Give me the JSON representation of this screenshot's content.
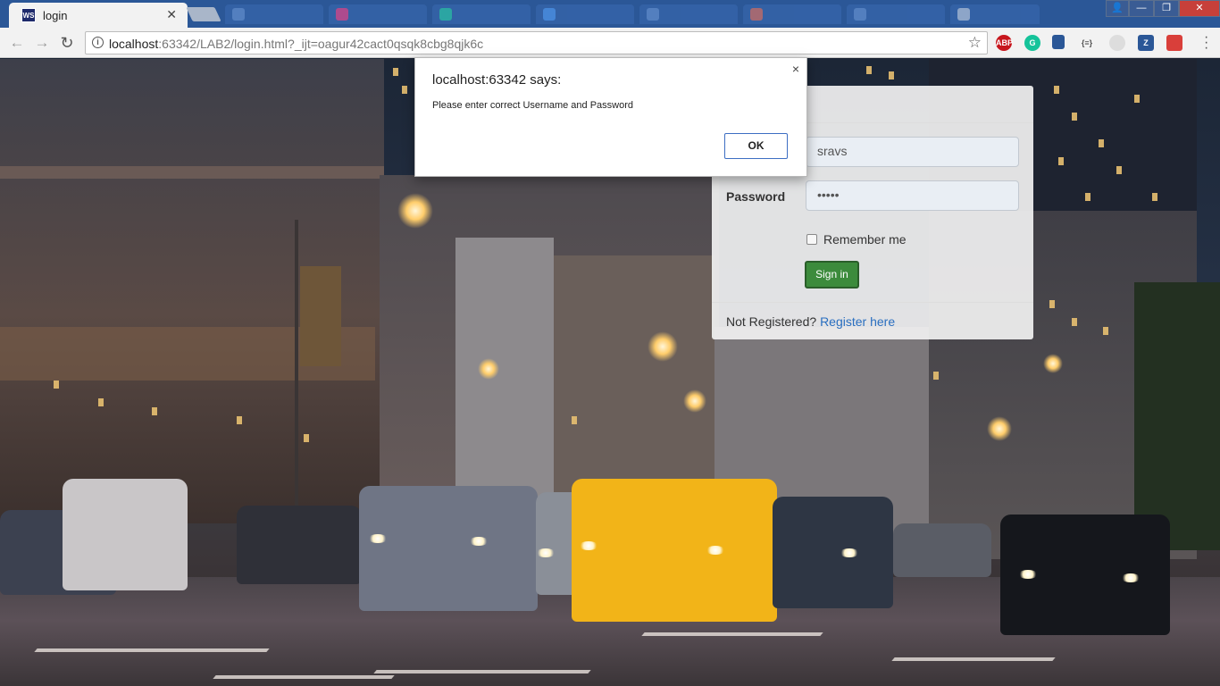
{
  "browser": {
    "active_tab_title": "login",
    "active_tab_icon": "webstorm-icon",
    "favicon_text": "WS",
    "url_host": "localhost",
    "url_rest": ":63342/LAB2/login.html?_ijt=oagur42cact0qsqk8cbg8qjk6c",
    "extensions": [
      {
        "name": "adblock-plus-icon",
        "text": "ABP",
        "color": "#c7161d"
      },
      {
        "name": "grammarly-icon",
        "text": "G",
        "color": "#15c39a"
      },
      {
        "name": "bookmark-extension-icon",
        "text": "",
        "color": "#2b5797"
      },
      {
        "name": "json-viewer-icon",
        "text": "{≡}",
        "color": "#ffffff"
      },
      {
        "name": "extension-grey-icon",
        "text": "",
        "color": "#bbbbbb"
      },
      {
        "name": "zotero-icon",
        "text": "Z",
        "color": "#2b5797"
      },
      {
        "name": "pocket-icon",
        "text": "",
        "color": "#d93f3a"
      }
    ]
  },
  "dialog": {
    "title": "localhost:63342 says:",
    "message": "Please enter correct Username and Password",
    "ok_label": "OK",
    "close_glyph": "×"
  },
  "login": {
    "username_value": "sravs",
    "password_label": "Password",
    "password_value": "•••••",
    "remember_label": "Remember me",
    "signin_label": "Sign in",
    "not_registered": "Not Registered? ",
    "register_link": "Register here"
  }
}
